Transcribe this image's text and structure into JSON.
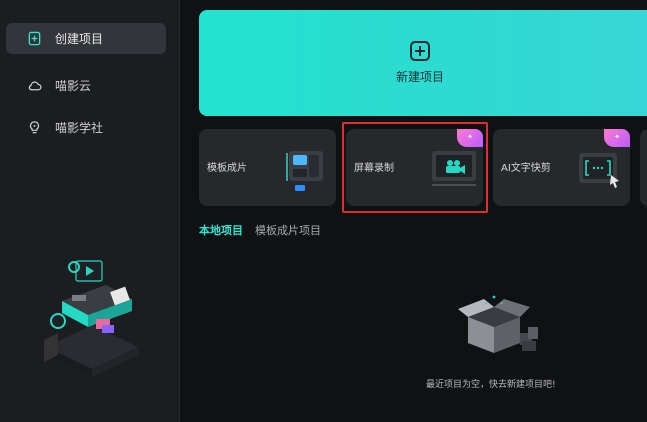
{
  "sidebar": {
    "items": [
      {
        "label": "创建项目",
        "icon": "add-file-icon",
        "active": true
      },
      {
        "label": "喵影云",
        "icon": "cloud-icon",
        "active": false
      },
      {
        "label": "喵影学社",
        "icon": "lightbulb-icon",
        "active": false
      }
    ]
  },
  "main": {
    "new_project": {
      "label": "新建项目",
      "icon": "plus-square-icon"
    },
    "cards": [
      {
        "label": "模板成片",
        "icon": "template-films-icon"
      },
      {
        "label": "屏幕录制",
        "icon": "screen-record-icon",
        "highlighted": true
      },
      {
        "label": "AI文字快剪",
        "icon": "ai-text-cut-icon"
      }
    ],
    "tabs": [
      {
        "label": "本地项目",
        "active": true
      },
      {
        "label": "模板成片项目",
        "active": false
      }
    ],
    "empty_message": "最近项目为空，快去新建项目吧!"
  },
  "colors": {
    "accent": "#2ee6d4",
    "highlight_border": "#e0302b",
    "sidebar_bg": "#1c1d20",
    "main_bg": "#101113"
  }
}
